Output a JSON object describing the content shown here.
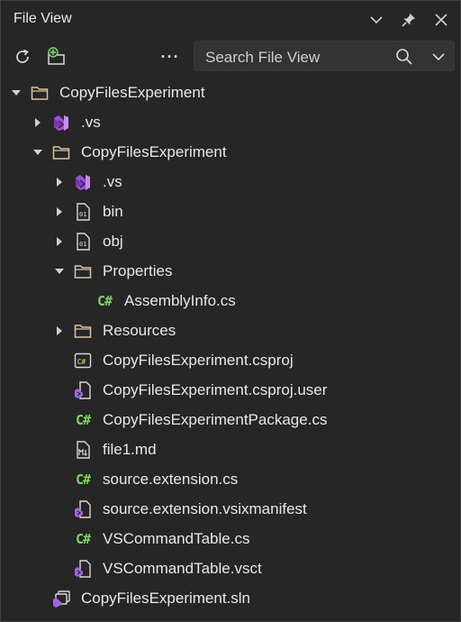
{
  "panel": {
    "title": "File View"
  },
  "search": {
    "placeholder": "Search File View"
  },
  "toolbar": {
    "more_label": "···"
  },
  "tree": {
    "rows": [
      {
        "label": "CopyFilesExperiment",
        "icon": "folder-icon",
        "level": 0,
        "expanded": true
      },
      {
        "label": ".vs",
        "icon": "vs-icon",
        "level": 1,
        "expanded": false
      },
      {
        "label": "CopyFilesExperiment",
        "icon": "folder-icon",
        "level": 1,
        "expanded": true
      },
      {
        "label": ".vs",
        "icon": "vs-icon",
        "level": 2,
        "expanded": false
      },
      {
        "label": "bin",
        "icon": "binary-file-icon",
        "level": 2,
        "expanded": false
      },
      {
        "label": "obj",
        "icon": "binary-file-icon",
        "level": 2,
        "expanded": false
      },
      {
        "label": "Properties",
        "icon": "folder-icon",
        "level": 2,
        "expanded": true
      },
      {
        "label": "AssemblyInfo.cs",
        "icon": "csharp-icon",
        "level": 3
      },
      {
        "label": "Resources",
        "icon": "folder-icon",
        "level": 2,
        "expanded": false
      },
      {
        "label": "CopyFilesExperiment.csproj",
        "icon": "csproj-icon",
        "level": 2
      },
      {
        "label": "CopyFilesExperiment.csproj.user",
        "icon": "vs-file-icon",
        "level": 2
      },
      {
        "label": "CopyFilesExperimentPackage.cs",
        "icon": "csharp-icon",
        "level": 2
      },
      {
        "label": "file1.md",
        "icon": "markdown-file-icon",
        "level": 2
      },
      {
        "label": "source.extension.cs",
        "icon": "csharp-icon",
        "level": 2
      },
      {
        "label": "source.extension.vsixmanifest",
        "icon": "vs-file-icon",
        "level": 2
      },
      {
        "label": "VSCommandTable.cs",
        "icon": "csharp-icon",
        "level": 2
      },
      {
        "label": "VSCommandTable.vsct",
        "icon": "vs-file-icon",
        "level": 2
      },
      {
        "label": "CopyFilesExperiment.sln",
        "icon": "solution-icon",
        "level": 1
      }
    ]
  },
  "colors": {
    "background": "#262626",
    "csharp_green": "#7fd65c",
    "vs_purple": "#b77ef1",
    "folder_stroke": "#d8c4a0"
  }
}
